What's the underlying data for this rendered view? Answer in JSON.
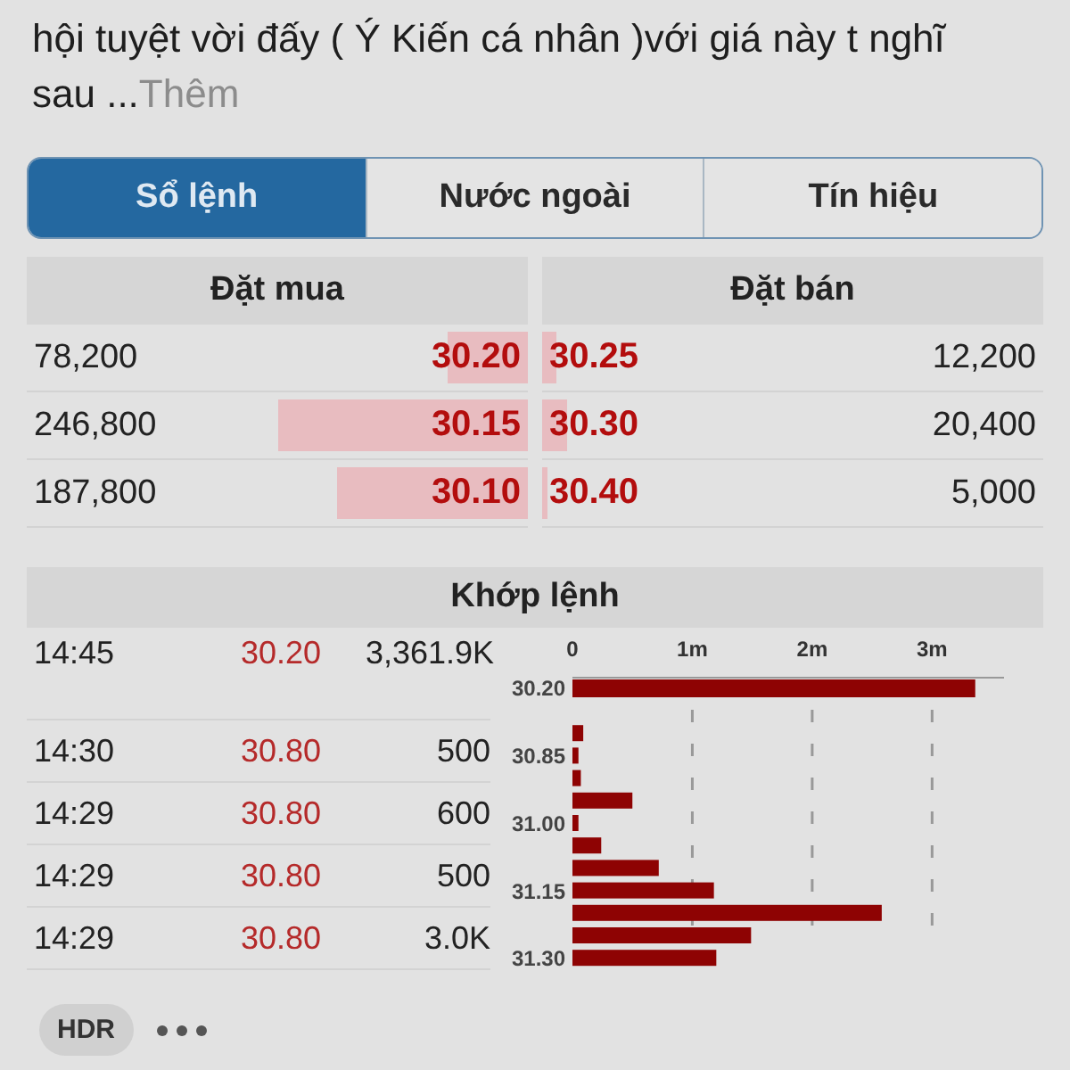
{
  "post": {
    "text": "hội tuyệt vời đấy ( Ý Kiến cá nhân )với giá này t nghĩ sau ...",
    "more_link": "Thêm"
  },
  "tabs": [
    {
      "label": "Sổ lệnh",
      "selected": true
    },
    {
      "label": "Nước ngoài",
      "selected": false
    },
    {
      "label": "Tín hiệu",
      "selected": false
    }
  ],
  "order_book": {
    "bid_header": "Đặt mua",
    "ask_header": "Đặt bán",
    "rows": [
      {
        "bid": {
          "volume": "78,200",
          "price": "30.20",
          "level": 0.16
        },
        "ask": {
          "price": "30.25",
          "level": 0.03,
          "volume": "12,200"
        }
      },
      {
        "bid": {
          "volume": "246,800",
          "price": "30.15",
          "level": 0.5
        },
        "ask": {
          "price": "30.30",
          "level": 0.05,
          "volume": "20,400"
        }
      },
      {
        "bid": {
          "volume": "187,800",
          "price": "30.10",
          "level": 0.38
        },
        "ask": {
          "price": "30.40",
          "level": 0.01,
          "volume": "5,000"
        }
      }
    ]
  },
  "matches": {
    "title": "Khớp lệnh",
    "rows": [
      {
        "time": "14:45",
        "price": "30.20",
        "volume": "3,361.9K"
      },
      {
        "time": "14:30",
        "price": "30.80",
        "volume": "500"
      },
      {
        "time": "14:29",
        "price": "30.80",
        "volume": "600"
      },
      {
        "time": "14:29",
        "price": "30.80",
        "volume": "500"
      },
      {
        "time": "14:29",
        "price": "30.80",
        "volume": "3.0K"
      }
    ],
    "chart_data": {
      "type": "bar",
      "orientation": "horizontal",
      "grid": true,
      "categories": [
        "30.20",
        null,
        "30.85",
        null,
        null,
        "31.00",
        null,
        null,
        "31.15",
        null,
        null,
        "31.30"
      ],
      "values": [
        3.36,
        0.09,
        0.05,
        0.07,
        0.5,
        0.05,
        0.24,
        0.72,
        1.18,
        2.58,
        1.49,
        1.2
      ],
      "xlim": [
        0,
        3.6
      ],
      "xticks": [
        {
          "value": 0,
          "label": "0"
        },
        {
          "value": 1,
          "label": "1m"
        },
        {
          "value": 2,
          "label": "2m"
        },
        {
          "value": 3,
          "label": "3m"
        }
      ]
    }
  },
  "footer": {
    "chip": "HDR"
  }
}
